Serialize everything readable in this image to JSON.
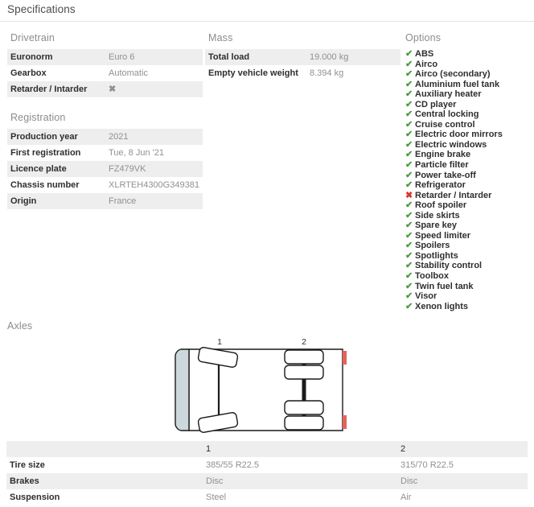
{
  "header": {
    "title": "Specifications"
  },
  "drivetrain": {
    "title": "Drivetrain",
    "rows": [
      {
        "key": "Euronorm",
        "value": "Euro 6",
        "type": "text"
      },
      {
        "key": "Gearbox",
        "value": "Automatic",
        "type": "text"
      },
      {
        "key": "Retarder / Intarder",
        "value": "✖",
        "type": "cross"
      }
    ]
  },
  "registration": {
    "title": "Registration",
    "rows": [
      {
        "key": "Production year",
        "value": "2021"
      },
      {
        "key": "First registration",
        "value": "Tue, 8 Jun '21"
      },
      {
        "key": "Licence plate",
        "value": "FZ479VK"
      },
      {
        "key": "Chassis number",
        "value": "XLRTEH4300G349381"
      },
      {
        "key": "Origin",
        "value": "France"
      }
    ]
  },
  "mass": {
    "title": "Mass",
    "rows": [
      {
        "key": "Total load",
        "value": "19.000 kg"
      },
      {
        "key": "Empty vehicle weight",
        "value": "8.394 kg"
      }
    ]
  },
  "options": {
    "title": "Options",
    "tick_glyph": "✔",
    "cross_glyph": "✖",
    "tick_color": "#4b9c3f",
    "cross_color": "#d9352c",
    "items": [
      {
        "label": "ABS",
        "present": true
      },
      {
        "label": "Airco",
        "present": true
      },
      {
        "label": "Airco (secondary)",
        "present": true
      },
      {
        "label": "Aluminium fuel tank",
        "present": true
      },
      {
        "label": "Auxiliary heater",
        "present": true
      },
      {
        "label": "CD player",
        "present": true
      },
      {
        "label": "Central locking",
        "present": true
      },
      {
        "label": "Cruise control",
        "present": true
      },
      {
        "label": "Electric door mirrors",
        "present": true
      },
      {
        "label": "Electric windows",
        "present": true
      },
      {
        "label": "Engine brake",
        "present": true
      },
      {
        "label": "Particle filter",
        "present": true
      },
      {
        "label": "Power take-off",
        "present": true
      },
      {
        "label": "Refrigerator",
        "present": true
      },
      {
        "label": "Retarder / Intarder",
        "present": false
      },
      {
        "label": "Roof spoiler",
        "present": true
      },
      {
        "label": "Side skirts",
        "present": true
      },
      {
        "label": "Spare key",
        "present": true
      },
      {
        "label": "Speed limiter",
        "present": true
      },
      {
        "label": "Spoilers",
        "present": true
      },
      {
        "label": "Spotlights",
        "present": true
      },
      {
        "label": "Stability control",
        "present": true
      },
      {
        "label": "Toolbox",
        "present": true
      },
      {
        "label": "Twin fuel tank",
        "present": true
      },
      {
        "label": "Visor",
        "present": true
      },
      {
        "label": "Xenon lights",
        "present": true
      }
    ]
  },
  "axles": {
    "title": "Axles",
    "diagram": {
      "axle_label_1": "1",
      "axle_label_2": "2",
      "cab_color": "#ccd8dc",
      "marker_color": "#e8625a",
      "outline_color": "#1a1a1a"
    },
    "table": {
      "columns": [
        "",
        "1",
        "2"
      ],
      "rows": [
        {
          "label": "Tire size",
          "values": [
            "385/55 R22.5",
            "315/70 R22.5"
          ]
        },
        {
          "label": "Brakes",
          "values": [
            "Disc",
            "Disc"
          ]
        },
        {
          "label": "Suspension",
          "values": [
            "Steel",
            "Air"
          ]
        }
      ]
    }
  }
}
